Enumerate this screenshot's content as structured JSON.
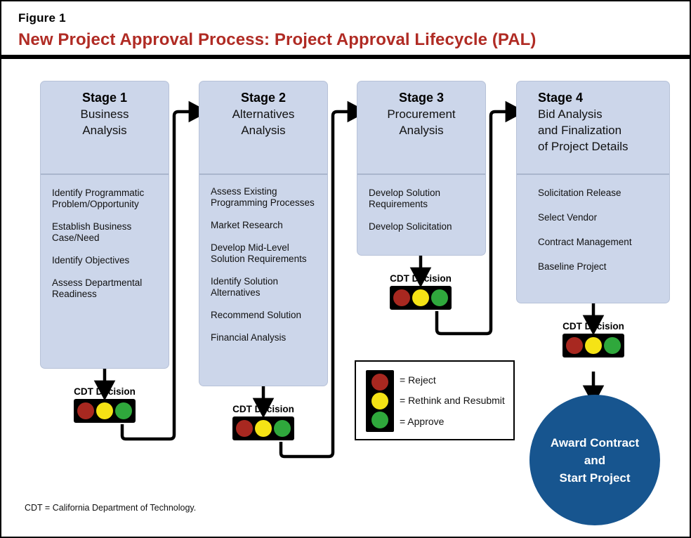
{
  "figure": {
    "label": "Figure 1",
    "title": "New Project Approval Process: Project Approval Lifecycle (PAL)",
    "title_color": "#b02b24",
    "footnote": "CDT = California Department of Technology."
  },
  "colors": {
    "stage_fill": "#ccd6ea",
    "stage_border": "#b7c2d8",
    "lamp_red": "#a82820",
    "lamp_yellow": "#f5e315",
    "lamp_green": "#2fa83c",
    "circle_blue": "#17558f",
    "frame_black": "#000000"
  },
  "stages": [
    {
      "number": "Stage 1",
      "subtitle": "Business\nAnalysis",
      "items": [
        "Identify Programmatic\nProblem/Opportunity",
        "Establish Business\nCase/Need",
        "Identify Objectives",
        "Assess Departmental\nReadiness"
      ]
    },
    {
      "number": "Stage 2",
      "subtitle": "Alternatives\nAnalysis",
      "items": [
        "Assess Existing\nProgramming Processes",
        "Market Research",
        "Develop Mid-Level\nSolution Requirements",
        "Identify Solution\nAlternatives",
        "Recommend Solution",
        "Financial Analysis"
      ]
    },
    {
      "number": "Stage 3",
      "subtitle": "Procurement\nAnalysis",
      "items": [
        "Develop Solution\nRequirements",
        "Develop Solicitation"
      ]
    },
    {
      "number": "Stage 4",
      "subtitle": "Bid Analysis\nand Finalization\nof Project Details",
      "items": [
        "Solicitation Release",
        "Select Vendor",
        "Contract Management",
        "Baseline Project"
      ]
    }
  ],
  "decisions": [
    {
      "label": "CDT Decision"
    },
    {
      "label": "CDT Decision"
    },
    {
      "label": "CDT Decision"
    },
    {
      "label": "CDT Decision"
    }
  ],
  "legend": {
    "rows": [
      "= Reject",
      "= Rethink and Resubmit",
      "= Approve"
    ]
  },
  "final": {
    "text": "Award Contract\nand\nStart Project"
  }
}
